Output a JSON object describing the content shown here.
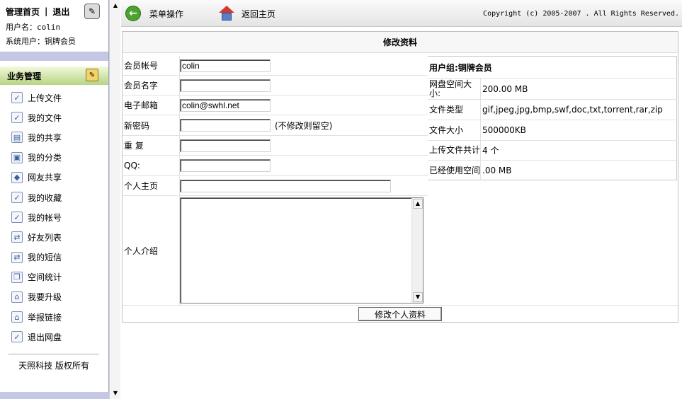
{
  "left": {
    "link_home": "管理首页",
    "separator": "|",
    "link_logout": "退出",
    "username_line": "用户名：colin",
    "role_line": "系统用户：铜牌会员",
    "menu_header": "业务管理",
    "menu_items": [
      "上传文件",
      "我的文件",
      "我的共享",
      "我的分类",
      "网友共享",
      "我的收藏",
      "我的帐号",
      "好友列表",
      "我的短信",
      "空间统计",
      "我要升级",
      "举报链接",
      "退出网盘"
    ],
    "footer": "天照科技 版权所有"
  },
  "toolbar": {
    "menu_ops": "菜单操作",
    "back_home": "返回主页",
    "copyright": "Copyright (c) 2005-2007 . All Rights Reserved."
  },
  "form": {
    "title": "修改资料",
    "account_label": "会员帐号",
    "account_value": "colin",
    "name_label": "会员名字",
    "name_value": "",
    "email_label": "电子邮箱",
    "email_value": "colin@swhl.net",
    "newpass_label": "新密码",
    "newpass_hint": "(不修改则留空)",
    "repeat_label": "重  复",
    "qq_label": "QQ:",
    "homepage_label": "个人主页",
    "intro_label": "个人介绍",
    "submit_label": "修改个人资料"
  },
  "info": {
    "group_header": "用户组:铜牌会员",
    "rows": [
      {
        "key": "网盘空间大小:",
        "value": "200.00 MB"
      },
      {
        "key": "文件类型",
        "value": "gif,jpeg,jpg,bmp,swf,doc,txt,torrent,rar,zip"
      },
      {
        "key": "文件大小",
        "value": "500000KB"
      },
      {
        "key": "上传文件共计",
        "value": "4 个"
      },
      {
        "key": "已经使用空间",
        "value": ".00 MB"
      }
    ]
  }
}
